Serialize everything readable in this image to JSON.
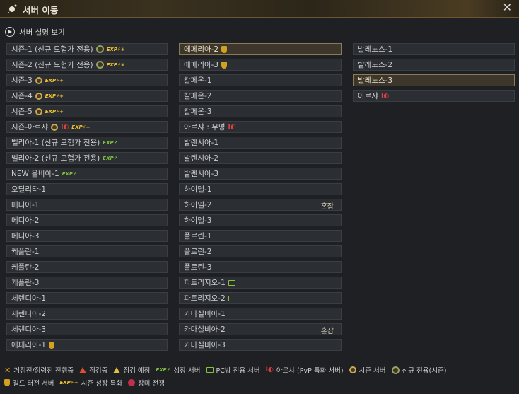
{
  "window": {
    "title": "서버 이동",
    "close_icon": "close-icon"
  },
  "description_link": "서버 설명 보기",
  "columns": [
    [
      {
        "name": "시즌-1 (신규 모험가 전용)",
        "icons": [
          "newseason",
          "exp"
        ]
      },
      {
        "name": "시즌-2 (신규 모험가 전용)",
        "icons": [
          "newseason",
          "exp"
        ]
      },
      {
        "name": "시즌-3",
        "icons": [
          "season",
          "exp"
        ]
      },
      {
        "name": "시즌-4",
        "icons": [
          "season",
          "exp"
        ]
      },
      {
        "name": "시즌-5",
        "icons": [
          "season",
          "exp"
        ]
      },
      {
        "name": "시즌-아르샤",
        "icons": [
          "season",
          "pvp",
          "exp"
        ]
      },
      {
        "name": "벨리아-1 (신규 모험가 전용)",
        "icons": [
          "growth"
        ]
      },
      {
        "name": "벨리아-2 (신규 모험가 전용)",
        "icons": [
          "growth"
        ]
      },
      {
        "name": "NEW 올비아-1",
        "icons": [
          "growth"
        ]
      },
      {
        "name": "오딜리타-1",
        "icons": []
      },
      {
        "name": "메디아-1",
        "icons": []
      },
      {
        "name": "메디아-2",
        "icons": []
      },
      {
        "name": "메디아-3",
        "icons": []
      },
      {
        "name": "케플란-1",
        "icons": []
      },
      {
        "name": "케플란-2",
        "icons": []
      },
      {
        "name": "케플란-3",
        "icons": []
      },
      {
        "name": "세렌디아-1",
        "icons": []
      },
      {
        "name": "세렌디아-2",
        "icons": []
      },
      {
        "name": "세렌디아-3",
        "icons": []
      },
      {
        "name": "에페리아-1",
        "icons": [
          "guild"
        ]
      }
    ],
    [
      {
        "name": "에페리아-2",
        "icons": [
          "guild"
        ],
        "selected": true
      },
      {
        "name": "에페리아-3",
        "icons": [
          "guild"
        ]
      },
      {
        "name": "칼페온-1",
        "icons": []
      },
      {
        "name": "칼페온-2",
        "icons": []
      },
      {
        "name": "칼페온-3",
        "icons": []
      },
      {
        "name": "아르샤 : 무명",
        "icons": [
          "pvp"
        ]
      },
      {
        "name": "발렌시아-1",
        "icons": []
      },
      {
        "name": "발렌시아-2",
        "icons": []
      },
      {
        "name": "발렌시아-3",
        "icons": []
      },
      {
        "name": "하이델-1",
        "icons": []
      },
      {
        "name": "하이델-2",
        "icons": [],
        "tag": "혼잡"
      },
      {
        "name": "하이델-3",
        "icons": []
      },
      {
        "name": "플로린-1",
        "icons": []
      },
      {
        "name": "플로린-2",
        "icons": []
      },
      {
        "name": "플로린-3",
        "icons": []
      },
      {
        "name": "파트리지오-1",
        "icons": [
          "pc"
        ]
      },
      {
        "name": "파트리지오-2",
        "icons": [
          "pc"
        ]
      },
      {
        "name": "카마실비아-1",
        "icons": []
      },
      {
        "name": "카마실비아-2",
        "icons": [],
        "tag": "혼잡"
      },
      {
        "name": "카마실비아-3",
        "icons": []
      }
    ],
    [
      {
        "name": "발레노스-1",
        "icons": []
      },
      {
        "name": "발레노스-2",
        "icons": []
      },
      {
        "name": "발레노스-3",
        "icons": [],
        "selected": true
      },
      {
        "name": "아르샤",
        "icons": [
          "pvp"
        ]
      }
    ]
  ],
  "legend": {
    "line1": [
      {
        "icon": "cross",
        "label": "거점전/점령전 진행중"
      },
      {
        "icon": "warn",
        "label": "점검중"
      },
      {
        "icon": "warn2",
        "label": "점검 예정"
      },
      {
        "icon": "growth",
        "label": "성장 서버"
      },
      {
        "icon": "pc",
        "label": "PC방 전용 서버"
      },
      {
        "icon": "pvp",
        "label": "아르샤 (PvP 특화 서버)"
      },
      {
        "icon": "season",
        "label": "시즌 서버"
      },
      {
        "icon": "newseason",
        "label": "신규 전용(시즌)"
      }
    ],
    "line2": [
      {
        "icon": "guild",
        "label": "길드 터전 서버"
      },
      {
        "icon": "exp",
        "label": "시즌 성장 특화"
      },
      {
        "icon": "rose",
        "label": "장미 전쟁"
      }
    ]
  },
  "icon_text": {
    "exp": "EXP⚡+",
    "growth": "EXP↗",
    "pvp": "I◐",
    "cross": "✕"
  },
  "colors": {
    "accent_gold": "#c9a85a",
    "selected_bg": "#3d362b",
    "pvp_red": "#e04040",
    "growth_green": "#7fc040"
  }
}
